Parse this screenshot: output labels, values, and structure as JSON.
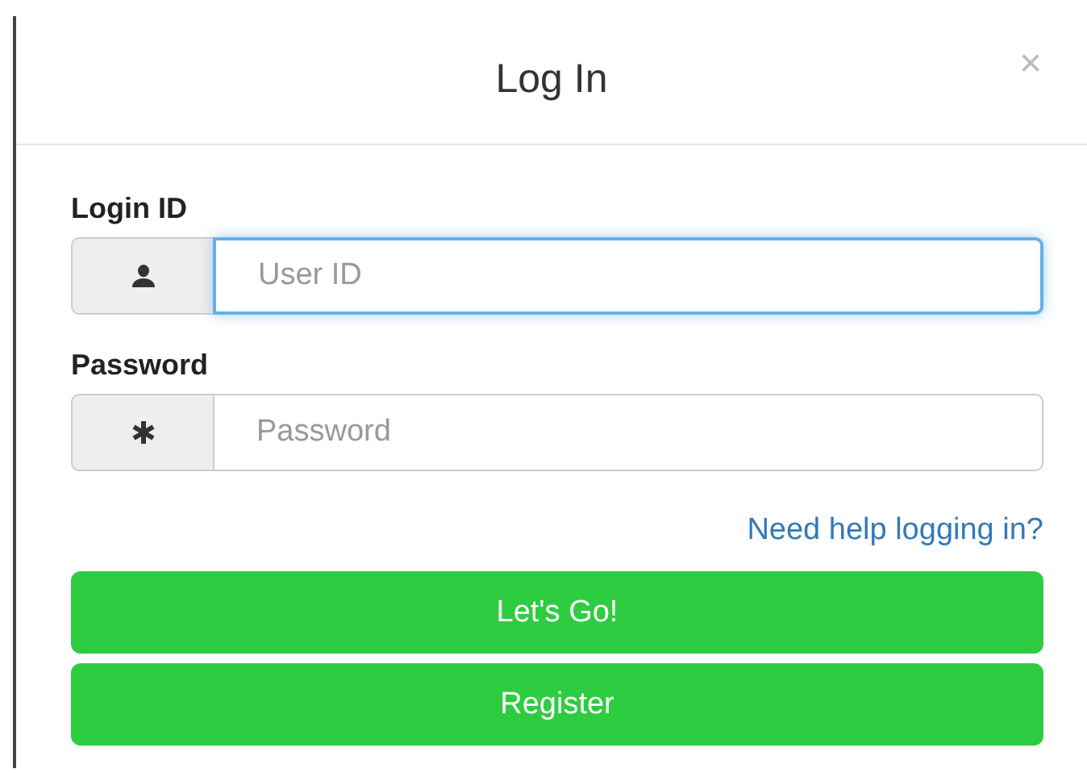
{
  "dialog": {
    "title": "Log In",
    "close": "×"
  },
  "fields": [
    {
      "label": "Login ID",
      "kind": "user",
      "placeholder": "User ID",
      "focused": true
    },
    {
      "label": "Password",
      "kind": "secret",
      "placeholder": "Password",
      "focused": false
    }
  ],
  "help_link": "Need help logging in?",
  "buttons": [
    "Let's Go!",
    "Register"
  ]
}
